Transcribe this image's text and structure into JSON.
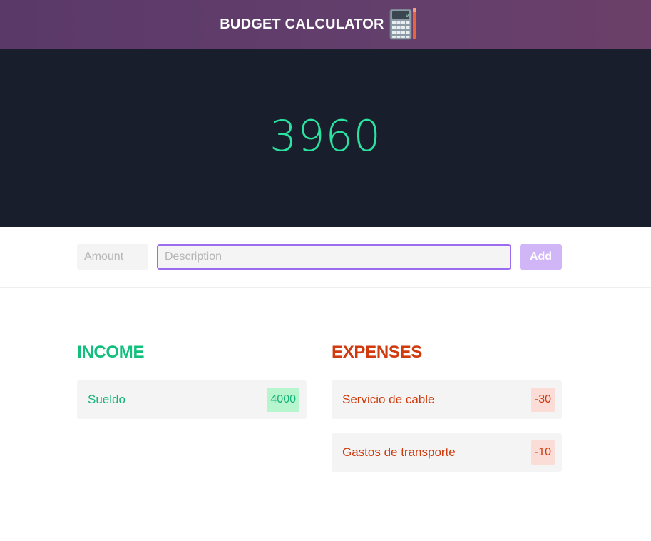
{
  "header": {
    "title": "BUDGET CALCULATOR",
    "icon": "calculator-icon"
  },
  "balance": {
    "value": "3960",
    "color": "#2be3a0"
  },
  "form": {
    "amount_placeholder": "Amount",
    "amount_value": "",
    "description_placeholder": "Description",
    "description_value": "",
    "add_label": "Add"
  },
  "income": {
    "heading": "INCOME",
    "color": "#12c07e",
    "items": [
      {
        "description": "Sueldo",
        "value": "4000"
      }
    ]
  },
  "expenses": {
    "heading": "EXPENSES",
    "color": "#d03a0c",
    "items": [
      {
        "description": "Servicio de cable",
        "value": "-30"
      },
      {
        "description": "Gastos de transporte",
        "value": "-10"
      }
    ]
  }
}
